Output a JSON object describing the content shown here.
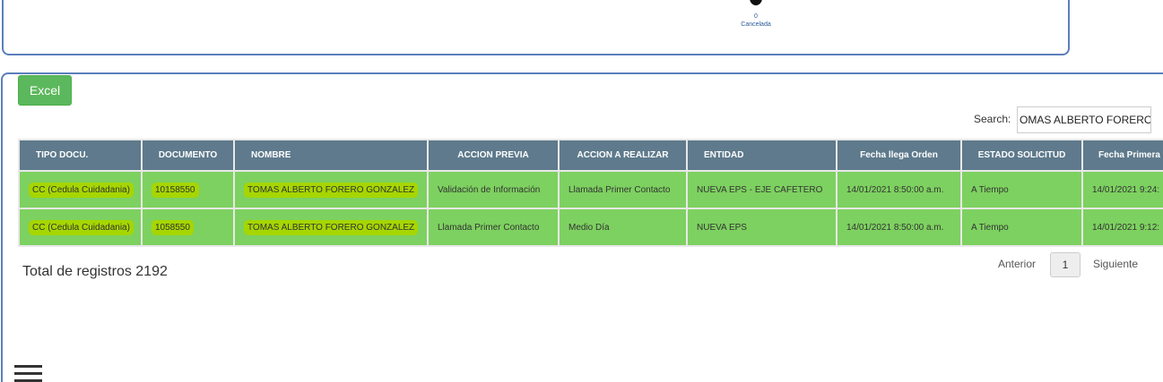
{
  "status_summary": {
    "count": "0",
    "label": "Cancelada"
  },
  "toolbar": {
    "excel_label": "Excel"
  },
  "search": {
    "label": "Search:",
    "value": "OMAS ALBERTO FORERO"
  },
  "table": {
    "headers": [
      "TIPO DOCU.",
      "DOCUMENTO",
      "NOMBRE",
      "ACCION PREVIA",
      "ACCION A REALIZAR",
      "ENTIDAD",
      "Fecha llega Orden",
      "ESTADO SOLICITUD",
      "Fecha Primera"
    ],
    "rows": [
      [
        "CC (Cedula Cuidadania)",
        "10158550",
        "TOMAS ALBERTO FORERO GONZALEZ",
        "Validación de Información",
        "Llamada Primer Contacto",
        "NUEVA EPS - EJE CAFETERO",
        "14/01/2021 8:50:00 a.m.",
        "A Tiempo",
        "14/01/2021 9:24:"
      ],
      [
        "CC (Cedula Cuidadania)",
        "1058550",
        "TOMAS ALBERTO FORERO GONZALEZ",
        "Llamada Primer Contacto",
        "Medio Día",
        "NUEVA EPS",
        "14/01/2021 8:50:00 a.m.",
        "A Tiempo",
        "14/01/2021 9:12:"
      ]
    ]
  },
  "footer": {
    "total_label": "Total de registros 2192",
    "prev_label": "Anterior",
    "page_number": "1",
    "next_label": "Siguiente"
  },
  "colors": {
    "header_bg": "#5e7a8c",
    "row_bg": "#7dd160",
    "highlight": "#a6d600",
    "excel_button": "#5cb85c",
    "panel_border": "#5b7fbc"
  },
  "icons": {
    "menu": "hamburger-menu-icon"
  }
}
